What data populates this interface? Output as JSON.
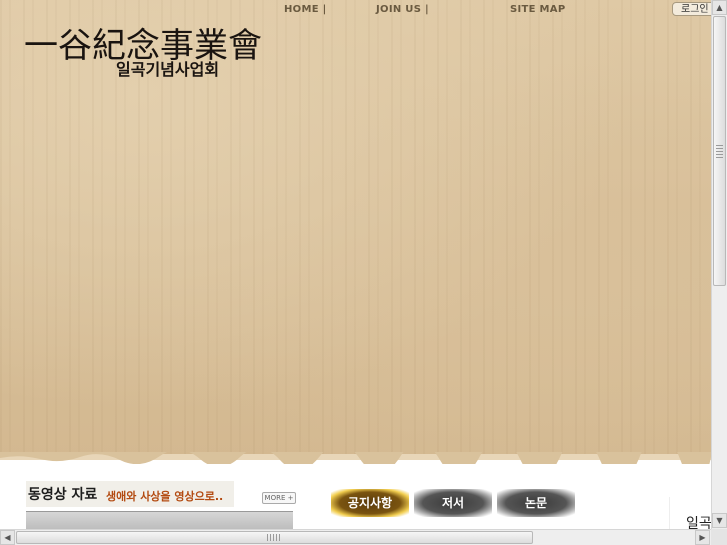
{
  "header": {
    "logo_hanja": "一谷紀念事業會",
    "logo_hangul": "일곡기념사업회"
  },
  "topnav": {
    "home": "HOME |",
    "join": "JOIN US |",
    "sitemap": "SITE MAP",
    "login": "로그인"
  },
  "video": {
    "title": "동영상 자료",
    "subtitle": "생애와 사상을 영상으로..",
    "more": "MORE +"
  },
  "tabs": {
    "notice": "공지사항",
    "books": "저서",
    "papers": "논문"
  },
  "side": {
    "text": "일곡"
  },
  "scrollbars": {
    "up": "▲",
    "down": "▼",
    "left": "◀",
    "right": "▶"
  }
}
